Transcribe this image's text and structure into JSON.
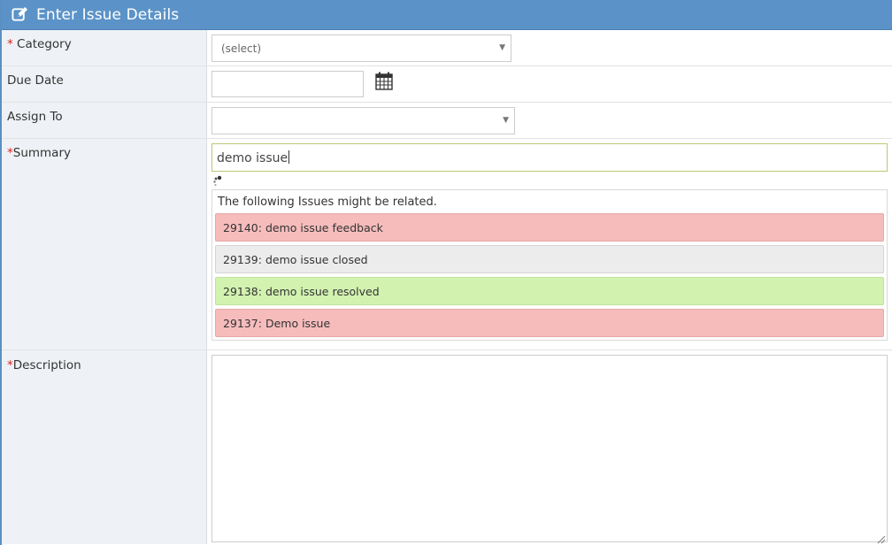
{
  "header": {
    "title": "Enter Issue Details",
    "icon": "edit-icon"
  },
  "colors": {
    "header_bg": "#5b93c8",
    "required": "#d9231f",
    "label_bg": "#eef2f6",
    "related_red": "#f6bcbc",
    "related_gray": "#ececec",
    "related_green": "#d2f2b0"
  },
  "form": {
    "required_marker": "*",
    "category": {
      "label": "Category",
      "value": "(select)"
    },
    "due_date": {
      "label": "Due Date",
      "value": "",
      "icon": "calendar-icon"
    },
    "assign_to": {
      "label": "Assign To",
      "value": ""
    },
    "summary": {
      "label": "Summary",
      "value": "demo issue",
      "spinner_icon": "loading-spinner-icon"
    },
    "related": {
      "heading": "The following Issues might be related.",
      "items": [
        {
          "text": "29140: demo issue feedback",
          "status": "red"
        },
        {
          "text": "29139: demo issue closed",
          "status": "gray"
        },
        {
          "text": "29138: demo issue resolved",
          "status": "green"
        },
        {
          "text": "29137: Demo issue",
          "status": "red"
        }
      ]
    },
    "description": {
      "label": "Description",
      "value": ""
    }
  }
}
